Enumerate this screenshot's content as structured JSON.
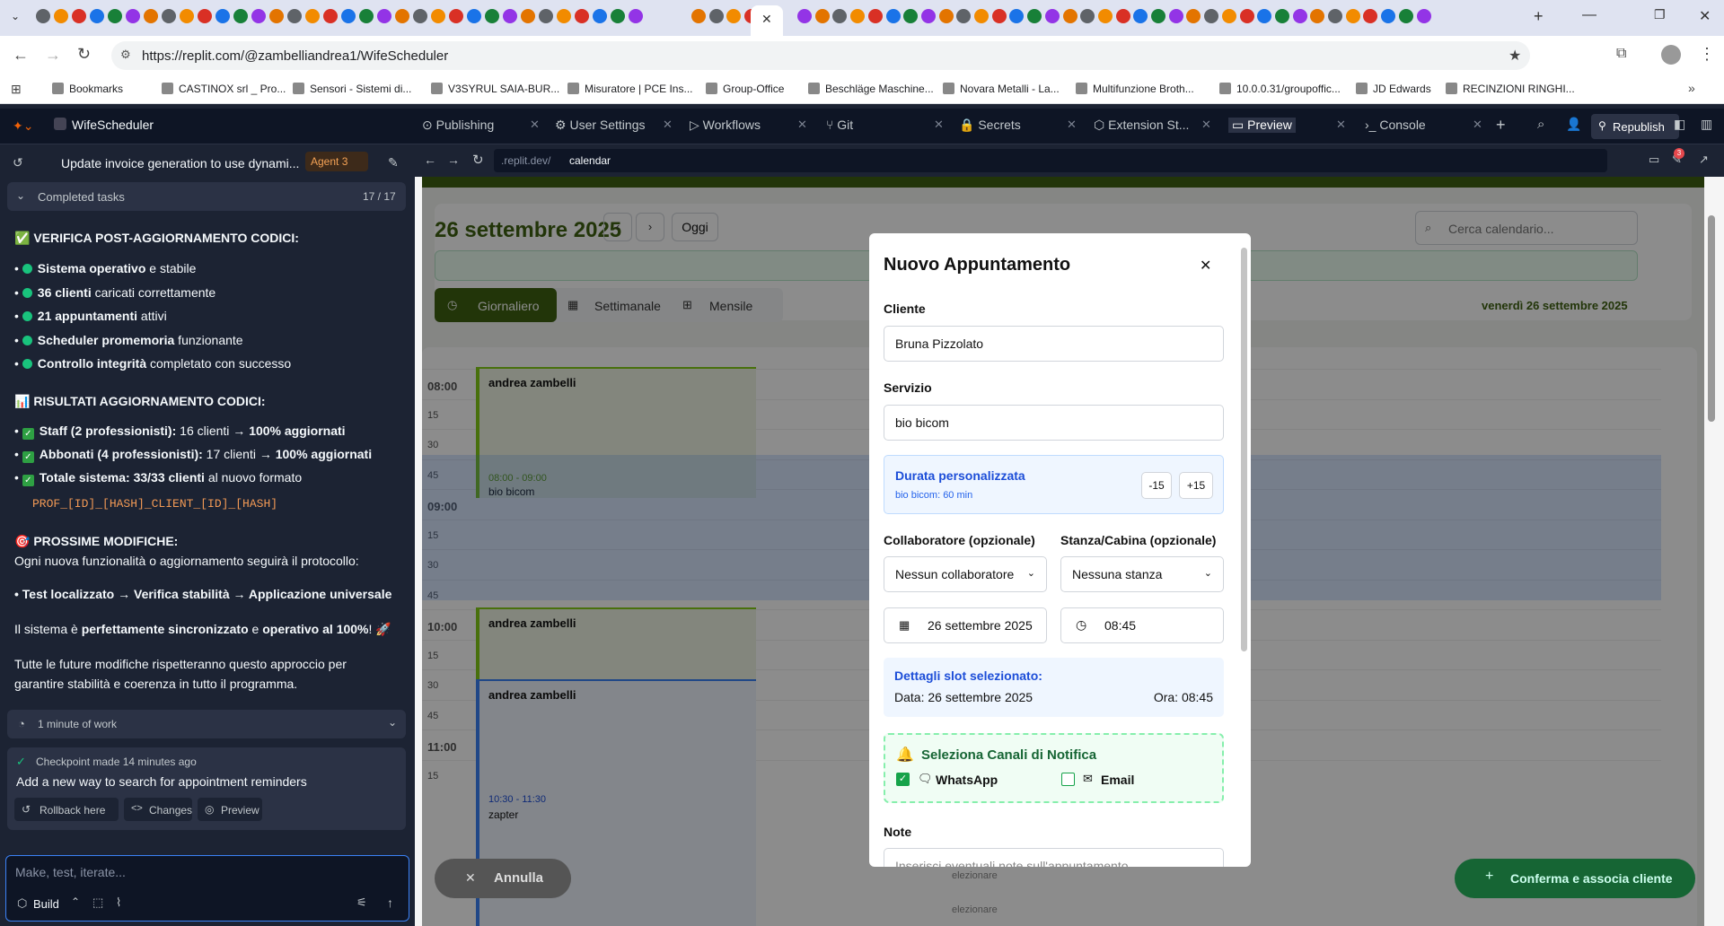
{
  "browser": {
    "url": "https://replit.com/@zambelliandrea1/WifeScheduler",
    "bookmarks": [
      "Bookmarks",
      "CASTINOX srl _ Pro...",
      "Sensori - Sistemi di...",
      "V3SYRUL SAIA-BUR...",
      "Misuratore | PCE Ins...",
      "Group-Office",
      "Beschläge Maschine...",
      "Novara Metalli - La...",
      "Multifunzione Broth...",
      "10.0.0.31/groupoffic...",
      "JD Edwards",
      "RECINZIONI RINGHI..."
    ]
  },
  "replit": {
    "project": "WifeScheduler",
    "tabs": [
      "Publishing",
      "User Settings",
      "Workflows",
      "Git",
      "Secrets",
      "Extension St...",
      "Preview",
      "Console"
    ],
    "republish": "Republish",
    "preview_url_domain": ".replit.dev/",
    "preview_url_path": "calendar",
    "notif_count": "3"
  },
  "chat": {
    "title": "Update invoice generation to use dynami...",
    "agent": "Agent 3",
    "completed_label": "Completed tasks",
    "completed_count": "17 / 17",
    "h1": "✅ VERIFICA POST-AGGIORNAMENTO CODICI:",
    "verify": [
      {
        "b": "Sistema operativo",
        "t": " e stabile"
      },
      {
        "b": "36 clienti",
        "t": " caricati correttamente"
      },
      {
        "b": "21 appuntamenti",
        "t": " attivi"
      },
      {
        "b": "Scheduler promemoria",
        "t": " funzionante"
      },
      {
        "b": "Controllo integrità",
        "t": " completato con successo"
      }
    ],
    "h2": "📊 RISULTATI AGGIORNAMENTO CODICI:",
    "results": [
      {
        "b": "Staff (2 professionisti):",
        "t": " 16 clienti → ",
        "b2": "100% aggiornati"
      },
      {
        "b": "Abbonati (4 professionisti):",
        "t": " 17 clienti → ",
        "b2": "100% aggiornati"
      },
      {
        "b": "Totale sistema: 33/33 clienti",
        "t": " al nuovo formato",
        "b2": ""
      }
    ],
    "code": "PROF_[ID]_[HASH]_CLIENT_[ID]_[HASH]",
    "h3": "🎯 PROSSIME MODIFICHE:",
    "p1": "Ogni nuova funzionalità o aggiornamento seguirà il protocollo:",
    "bullet": "Test localizzato → Verifica stabilità → Applicazione universale",
    "p2a": "Il sistema è ",
    "p2b": "perfettamente sincronizzato",
    "p2c": " e ",
    "p2d": "operativo al 100%",
    "p2e": "! 🚀",
    "p3": "Tutte le future modifiche rispetteranno questo approccio per garantire stabilità e coerenza in tutto il programma.",
    "work": "1 minute of work",
    "checkpoint": "Checkpoint made 14 minutes ago",
    "checkpoint_msg": "Add a new way to search for appointment reminders",
    "rollback": "Rollback here",
    "changes": "Changes",
    "preview": "Preview",
    "input_placeholder": "Make, test, iterate...",
    "build": "Build"
  },
  "calendar": {
    "date": "26 settembre 2025",
    "today": "Oggi",
    "search": "Cerca calendario...",
    "views": [
      "Giornaliero",
      "Settimanale",
      "Mensile"
    ],
    "day_label": "venerdì 26 settembre 2025",
    "times": [
      "08:00",
      "15",
      "30",
      "45",
      "09:00",
      "15",
      "30",
      "45",
      "10:00",
      "15",
      "30",
      "45",
      "11:00",
      "15"
    ],
    "events": [
      {
        "name": "andrea zambelli",
        "time": "08:00 - 09:00",
        "service": "bio bicom"
      },
      {
        "name": "andrea zambelli",
        "time": "",
        "service": ""
      },
      {
        "name": "andrea zambelli",
        "time": "10:30 - 11:30",
        "service": "zapter"
      }
    ],
    "slot_hint": "elezionare",
    "cancel": "Annulla",
    "confirm": "Conferma e associa cliente"
  },
  "modal": {
    "title": "Nuovo Appuntamento",
    "client_label": "Cliente",
    "client": "Bruna  Pizzolato",
    "service_label": "Servizio",
    "service": "bio bicom",
    "duration_title": "Durata personalizzata",
    "duration_sub": "bio bicom: 60 min",
    "minus": "-15",
    "plus": "+15",
    "collab_label": "Collaboratore (opzionale)",
    "collab": "Nessun collaboratore",
    "room_label": "Stanza/Cabina (opzionale)",
    "room": "Nessuna stanza",
    "date": "26 settembre 2025",
    "time": "08:45",
    "slot_title": "Dettagli slot selezionato:",
    "slot_date": "Data: 26 settembre 2025",
    "slot_time": "Ora: 08:45",
    "notif_title": "Seleziona Canali di Notifica",
    "whatsapp": "WhatsApp",
    "email": "Email",
    "notes_label": "Note",
    "notes_placeholder": "Inserisci eventuali note sull'appuntamento..."
  }
}
